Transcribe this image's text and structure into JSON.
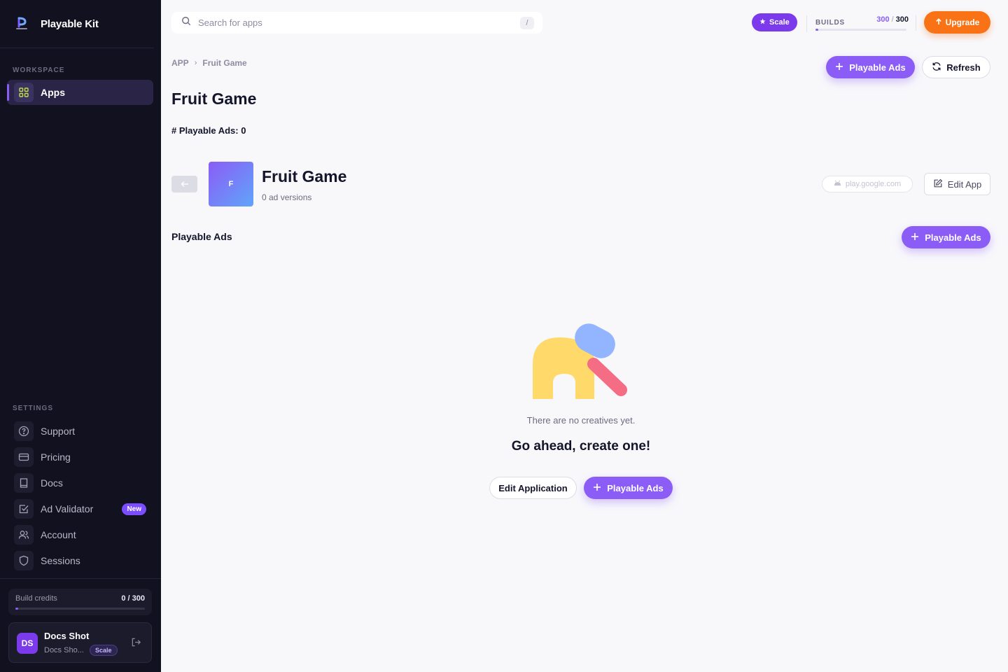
{
  "brand": {
    "name": "Playable Kit"
  },
  "sidebar": {
    "workspace_label": "WORKSPACE",
    "workspace_items": [
      {
        "label": "Apps",
        "icon": "grid-icon"
      }
    ],
    "settings_label": "SETTINGS",
    "settings_items": [
      {
        "label": "Support",
        "icon": "help-circle-icon"
      },
      {
        "label": "Pricing",
        "icon": "credit-card-icon"
      },
      {
        "label": "Docs",
        "icon": "book-icon"
      },
      {
        "label": "Ad Validator",
        "icon": "check-square-icon",
        "badge": "New"
      },
      {
        "label": "Account",
        "icon": "users-icon"
      },
      {
        "label": "Sessions",
        "icon": "shield-icon"
      }
    ],
    "credits": {
      "label": "Build credits",
      "value": "0 / 300",
      "fraction": 0.0
    },
    "user": {
      "initials": "DS",
      "name": "Docs Shot",
      "sub": "Docs Sho...",
      "plan": "Scale"
    }
  },
  "topbar": {
    "search_placeholder": "Search for apps",
    "shortcut": "/",
    "plan": "Scale",
    "builds_label": "BUILDS",
    "builds_used": "300",
    "builds_sep": "/",
    "builds_total": "300",
    "upgrade_label": "Upgrade"
  },
  "breadcrumb": {
    "root": "APP",
    "sep": "›",
    "current": "Fruit Game"
  },
  "header_actions": {
    "create_label": "Playable Ads",
    "refresh_label": "Refresh"
  },
  "page": {
    "title": "Fruit Game",
    "ads_count": "# Playable Ads: 0"
  },
  "app": {
    "initial": "F",
    "name": "Fruit Game",
    "versions": "0 ad versions",
    "store_link": "play.google.com",
    "edit_label": "Edit App"
  },
  "section": {
    "title": "Playable Ads",
    "create_label": "Playable Ads"
  },
  "empty_state": {
    "text": "There are no creatives yet.",
    "cta": "Go ahead, create one!",
    "edit_label": "Edit Application",
    "create_label": "Playable Ads"
  },
  "colors": {
    "accent": "#8b5cf6",
    "sidebar_bg": "#12111f",
    "upgrade": "#f97316"
  }
}
